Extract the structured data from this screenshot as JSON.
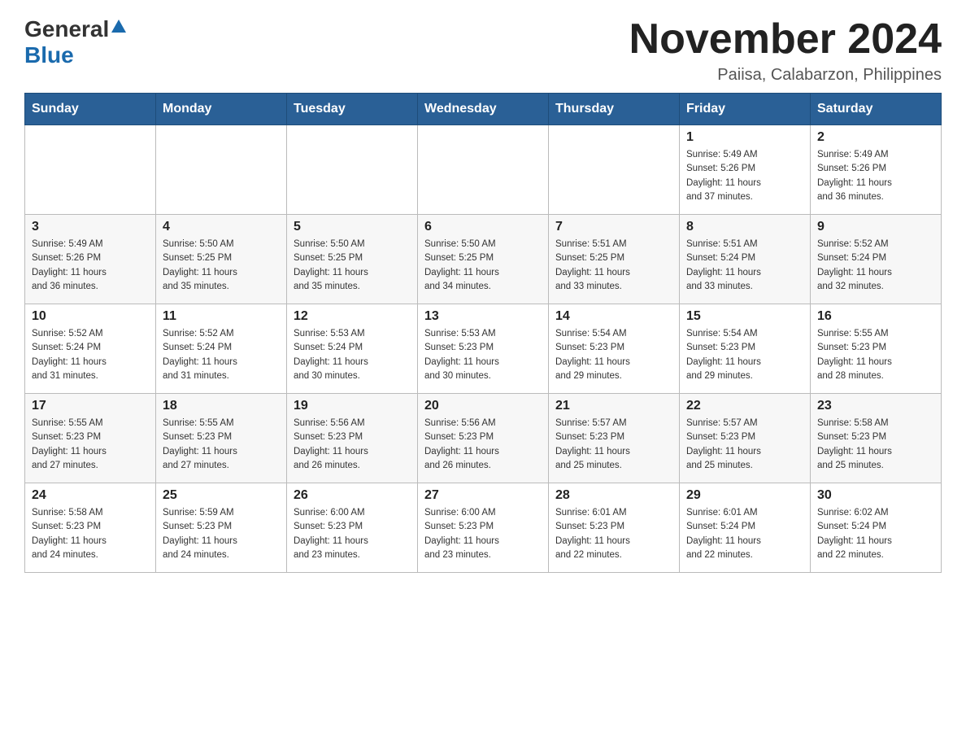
{
  "logo": {
    "general": "General",
    "blue": "Blue"
  },
  "title": {
    "main": "November 2024",
    "sub": "Paiisa, Calabarzon, Philippines"
  },
  "weekdays": [
    "Sunday",
    "Monday",
    "Tuesday",
    "Wednesday",
    "Thursday",
    "Friday",
    "Saturday"
  ],
  "weeks": [
    {
      "days": [
        {
          "num": "",
          "info": ""
        },
        {
          "num": "",
          "info": ""
        },
        {
          "num": "",
          "info": ""
        },
        {
          "num": "",
          "info": ""
        },
        {
          "num": "",
          "info": ""
        },
        {
          "num": "1",
          "info": "Sunrise: 5:49 AM\nSunset: 5:26 PM\nDaylight: 11 hours\nand 37 minutes."
        },
        {
          "num": "2",
          "info": "Sunrise: 5:49 AM\nSunset: 5:26 PM\nDaylight: 11 hours\nand 36 minutes."
        }
      ]
    },
    {
      "days": [
        {
          "num": "3",
          "info": "Sunrise: 5:49 AM\nSunset: 5:26 PM\nDaylight: 11 hours\nand 36 minutes."
        },
        {
          "num": "4",
          "info": "Sunrise: 5:50 AM\nSunset: 5:25 PM\nDaylight: 11 hours\nand 35 minutes."
        },
        {
          "num": "5",
          "info": "Sunrise: 5:50 AM\nSunset: 5:25 PM\nDaylight: 11 hours\nand 35 minutes."
        },
        {
          "num": "6",
          "info": "Sunrise: 5:50 AM\nSunset: 5:25 PM\nDaylight: 11 hours\nand 34 minutes."
        },
        {
          "num": "7",
          "info": "Sunrise: 5:51 AM\nSunset: 5:25 PM\nDaylight: 11 hours\nand 33 minutes."
        },
        {
          "num": "8",
          "info": "Sunrise: 5:51 AM\nSunset: 5:24 PM\nDaylight: 11 hours\nand 33 minutes."
        },
        {
          "num": "9",
          "info": "Sunrise: 5:52 AM\nSunset: 5:24 PM\nDaylight: 11 hours\nand 32 minutes."
        }
      ]
    },
    {
      "days": [
        {
          "num": "10",
          "info": "Sunrise: 5:52 AM\nSunset: 5:24 PM\nDaylight: 11 hours\nand 31 minutes."
        },
        {
          "num": "11",
          "info": "Sunrise: 5:52 AM\nSunset: 5:24 PM\nDaylight: 11 hours\nand 31 minutes."
        },
        {
          "num": "12",
          "info": "Sunrise: 5:53 AM\nSunset: 5:24 PM\nDaylight: 11 hours\nand 30 minutes."
        },
        {
          "num": "13",
          "info": "Sunrise: 5:53 AM\nSunset: 5:23 PM\nDaylight: 11 hours\nand 30 minutes."
        },
        {
          "num": "14",
          "info": "Sunrise: 5:54 AM\nSunset: 5:23 PM\nDaylight: 11 hours\nand 29 minutes."
        },
        {
          "num": "15",
          "info": "Sunrise: 5:54 AM\nSunset: 5:23 PM\nDaylight: 11 hours\nand 29 minutes."
        },
        {
          "num": "16",
          "info": "Sunrise: 5:55 AM\nSunset: 5:23 PM\nDaylight: 11 hours\nand 28 minutes."
        }
      ]
    },
    {
      "days": [
        {
          "num": "17",
          "info": "Sunrise: 5:55 AM\nSunset: 5:23 PM\nDaylight: 11 hours\nand 27 minutes."
        },
        {
          "num": "18",
          "info": "Sunrise: 5:55 AM\nSunset: 5:23 PM\nDaylight: 11 hours\nand 27 minutes."
        },
        {
          "num": "19",
          "info": "Sunrise: 5:56 AM\nSunset: 5:23 PM\nDaylight: 11 hours\nand 26 minutes."
        },
        {
          "num": "20",
          "info": "Sunrise: 5:56 AM\nSunset: 5:23 PM\nDaylight: 11 hours\nand 26 minutes."
        },
        {
          "num": "21",
          "info": "Sunrise: 5:57 AM\nSunset: 5:23 PM\nDaylight: 11 hours\nand 25 minutes."
        },
        {
          "num": "22",
          "info": "Sunrise: 5:57 AM\nSunset: 5:23 PM\nDaylight: 11 hours\nand 25 minutes."
        },
        {
          "num": "23",
          "info": "Sunrise: 5:58 AM\nSunset: 5:23 PM\nDaylight: 11 hours\nand 25 minutes."
        }
      ]
    },
    {
      "days": [
        {
          "num": "24",
          "info": "Sunrise: 5:58 AM\nSunset: 5:23 PM\nDaylight: 11 hours\nand 24 minutes."
        },
        {
          "num": "25",
          "info": "Sunrise: 5:59 AM\nSunset: 5:23 PM\nDaylight: 11 hours\nand 24 minutes."
        },
        {
          "num": "26",
          "info": "Sunrise: 6:00 AM\nSunset: 5:23 PM\nDaylight: 11 hours\nand 23 minutes."
        },
        {
          "num": "27",
          "info": "Sunrise: 6:00 AM\nSunset: 5:23 PM\nDaylight: 11 hours\nand 23 minutes."
        },
        {
          "num": "28",
          "info": "Sunrise: 6:01 AM\nSunset: 5:23 PM\nDaylight: 11 hours\nand 22 minutes."
        },
        {
          "num": "29",
          "info": "Sunrise: 6:01 AM\nSunset: 5:24 PM\nDaylight: 11 hours\nand 22 minutes."
        },
        {
          "num": "30",
          "info": "Sunrise: 6:02 AM\nSunset: 5:24 PM\nDaylight: 11 hours\nand 22 minutes."
        }
      ]
    }
  ]
}
